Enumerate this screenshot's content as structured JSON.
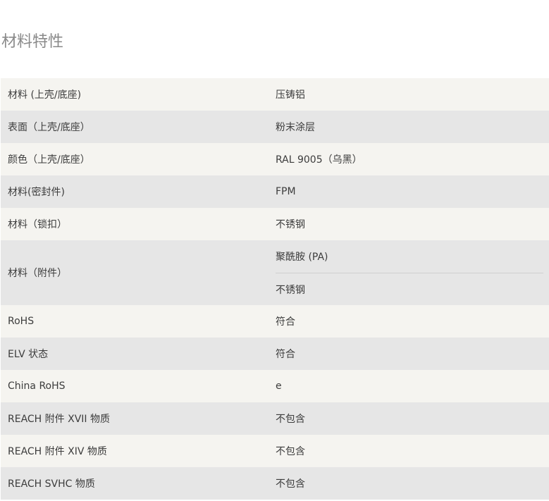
{
  "section": {
    "title": "材料特性"
  },
  "rows": [
    {
      "label": "材料 (上壳/底座)",
      "values": [
        "压铸铝"
      ]
    },
    {
      "label": "表面（上壳/底座）",
      "values": [
        "粉末涂层"
      ]
    },
    {
      "label": "颜色（上壳/底座）",
      "values": [
        "RAL 9005（乌黑）"
      ]
    },
    {
      "label": "材料(密封件)",
      "values": [
        "FPM"
      ]
    },
    {
      "label": "材料（锁扣）",
      "values": [
        "不锈钢"
      ]
    },
    {
      "label": "材料（附件）",
      "values": [
        "聚酰胺 (PA)",
        "不锈钢"
      ]
    },
    {
      "label": "RoHS",
      "values": [
        "符合"
      ]
    },
    {
      "label": "ELV 状态",
      "values": [
        "符合"
      ]
    },
    {
      "label": "China RoHS",
      "values": [
        "e"
      ]
    },
    {
      "label": "REACH 附件 XVII 物质",
      "values": [
        "不包含"
      ]
    },
    {
      "label": "REACH 附件 XIV 物质",
      "values": [
        "不包含"
      ]
    },
    {
      "label": "REACH SVHC 物质",
      "values": [
        "不包含"
      ]
    }
  ]
}
